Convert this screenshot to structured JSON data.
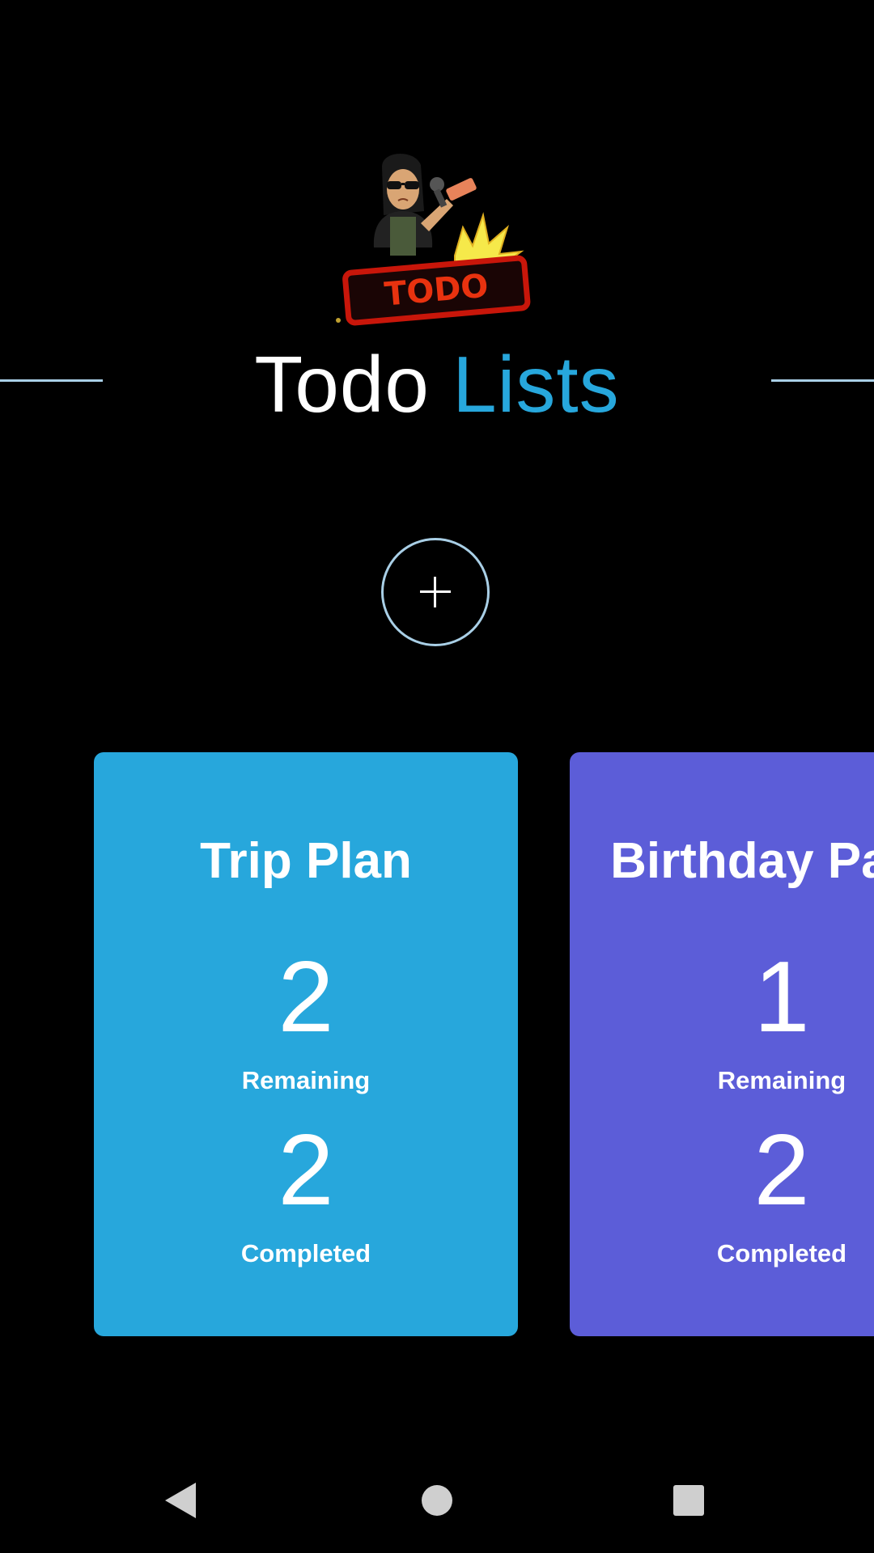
{
  "app": {
    "logo_icon": "bitmoji-todo-stamp-logo",
    "logo_text": "TODO"
  },
  "header": {
    "title_part1": "Todo",
    "title_part2": "Lists",
    "title_part1_color": "#ffffff",
    "title_part2_color": "#27a7dc",
    "divider_color": "#a9cfe6"
  },
  "add_button": {
    "icon": "plus-icon"
  },
  "lists": [
    {
      "title": "Trip Plan",
      "remaining_count": "2",
      "remaining_label": "Remaining",
      "completed_count": "2",
      "completed_label": "Completed",
      "color": "#27a7dc"
    },
    {
      "title": "Birthday Party",
      "remaining_count": "1",
      "remaining_label": "Remaining",
      "completed_count": "2",
      "completed_label": "Completed",
      "color": "#5c5dd8"
    }
  ],
  "navbar": {
    "back_icon": "back-triangle-icon",
    "home_icon": "home-circle-icon",
    "recents_icon": "recents-square-icon"
  }
}
